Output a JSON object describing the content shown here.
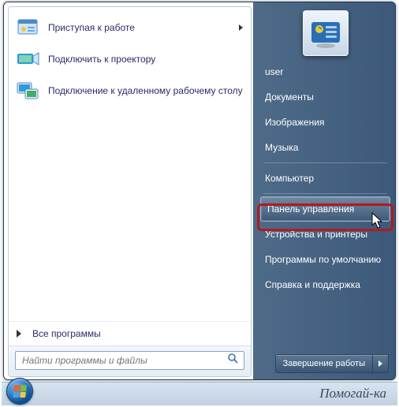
{
  "left": {
    "items": [
      {
        "label": "Приступая к работе",
        "has_submenu": true
      },
      {
        "label": "Подключить к проектору",
        "has_submenu": false
      },
      {
        "label": "Подключение к удаленному рабочему столу",
        "has_submenu": false
      }
    ],
    "all_programs": "Все программы",
    "search_placeholder": "Найти программы и файлы"
  },
  "right": {
    "user": "user",
    "items_group1": [
      "Документы",
      "Изображения",
      "Музыка"
    ],
    "items_group2": [
      "Компьютер"
    ],
    "items_group3": [
      "Панель управления",
      "Устройства и принтеры",
      "Программы по умолчанию",
      "Справка и поддержка"
    ],
    "highlighted": "Панель управления",
    "shutdown": "Завершение работы"
  },
  "taskbar": {
    "brand": "Помогай-ка"
  },
  "colors": {
    "flag": [
      "#e06a2b",
      "#7fba3c",
      "#4aa3e0",
      "#f2c83a"
    ]
  }
}
